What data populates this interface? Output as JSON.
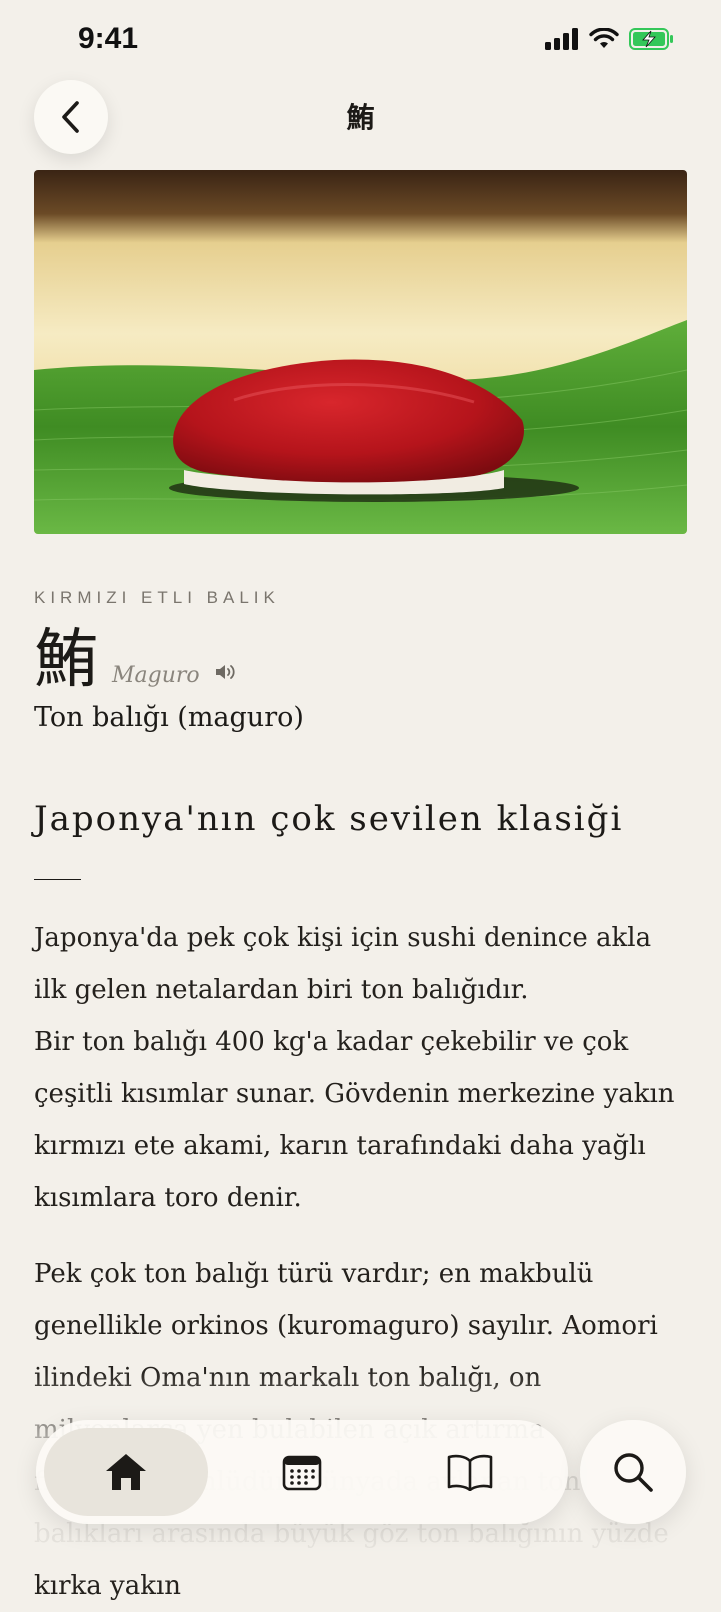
{
  "status_bar": {
    "time": "9:41",
    "battery_color": "#34c759"
  },
  "nav": {
    "title": "鮪",
    "back_icon": "chevron-left-icon"
  },
  "hero": {
    "image": "sushi-photo",
    "description_colors": {
      "tuna": "#b8151d",
      "leaf": "#4f9a2c",
      "counter": "#f2e4b5"
    }
  },
  "fish": {
    "category": "KIRMIZI ETLI BALIK",
    "kanji": "鮪",
    "romaji": "Maguro",
    "name": "Ton balığı (maguro)"
  },
  "article": {
    "heading": "Japonya'nın çok sevilen klasiği",
    "paragraphs": [
      "Japonya'da pek çok kişi için sushi denince akla ilk gelen netalardan biri ton balığıdır.\nBir ton balığı 400 kg'a kadar çekebilir ve çok çeşitli kısımlar sunar. Gövdenin merkezine yakın kırmızı ete akami, karın tarafındaki daha yağlı kısımlara toro denir.",
      "Pek çok ton balığı türü vardır; en makbulü genellikle orkinos (kuromaguro) sayılır. Aomori ilindeki Oma'nın markalı ton balığı, on milyonlarca yen bulabilen açık artırma fiyatlarıyla ünlüdür. Dünyada avlanan ton balıkları arasında büyük göz ton balığının yüzde kırka yakın"
    ]
  },
  "tab_bar": {
    "tabs": [
      {
        "name": "home",
        "icon": "home-icon",
        "active": true
      },
      {
        "name": "calendar",
        "icon": "calendar-icon",
        "active": false
      },
      {
        "name": "book",
        "icon": "book-icon",
        "active": false
      }
    ],
    "search_icon": "search-icon"
  }
}
